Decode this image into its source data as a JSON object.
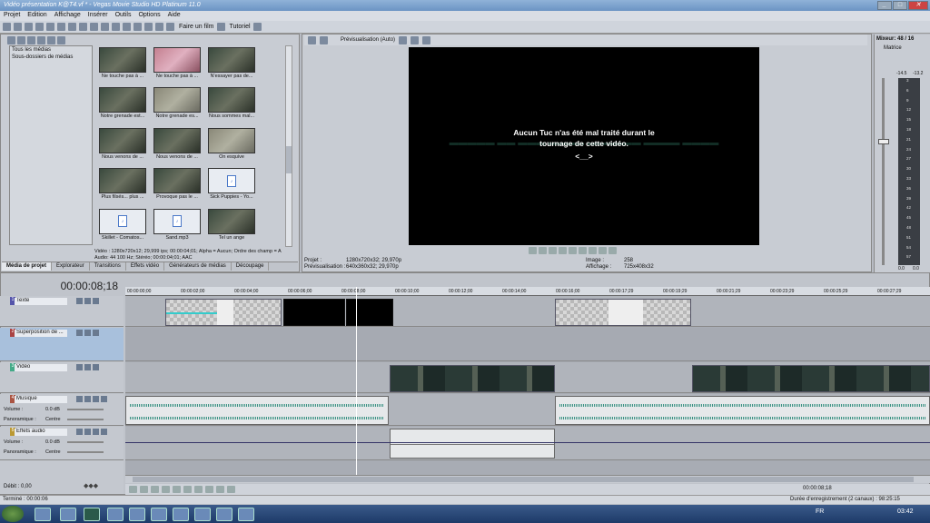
{
  "window": {
    "title": "Vidéo présentation K@T4.vf * - Vegas Movie Studio HD Platinum 11.0"
  },
  "menu": [
    "Projet",
    "Edition",
    "Affichage",
    "Insérer",
    "Outils",
    "Options",
    "Aide"
  ],
  "toolbar": {
    "make_movie": "Faire un film",
    "tutorial": "Tutoriel"
  },
  "explorer": {
    "items": [
      "Tous les médias",
      "Sous-dossiers de médias"
    ]
  },
  "media": [
    {
      "label": "Ne touche pas à ...",
      "kind": "video"
    },
    {
      "label": "Ne touche pas à ...",
      "kind": "pink"
    },
    {
      "label": "N'essayer pas de...",
      "kind": "video"
    },
    {
      "label": "Notre grenade est...",
      "kind": "video"
    },
    {
      "label": "Notre grenade es...",
      "kind": "light"
    },
    {
      "label": "Nous sommes mal...",
      "kind": "video"
    },
    {
      "label": "Nous venons de ...",
      "kind": "video"
    },
    {
      "label": "Nous venons de ...",
      "kind": "video"
    },
    {
      "label": "On esquive",
      "kind": "light"
    },
    {
      "label": "Plus filsés... plus ...",
      "kind": "video"
    },
    {
      "label": "Provoque pas le ...",
      "kind": "video"
    },
    {
      "label": "Sick Puppies - Yo...",
      "kind": "audio"
    },
    {
      "label": "Skillet - Comatos...",
      "kind": "audio"
    },
    {
      "label": "Sand.mp3",
      "kind": "audio"
    },
    {
      "label": "Tel un ange",
      "kind": "video"
    }
  ],
  "media_info": {
    "line1": "Vidéo : 1280x720x12; 29,999 ips; 00:00:04;01; Alpha = Aucun; Ordre des champ = A",
    "line2": "Audio: 44 100 Hz; Stéréo; 00:00:04;01; AAC"
  },
  "tabs": [
    "Média de projet",
    "Explorateur",
    "Transitions",
    "Effets vidéo",
    "Générateurs de médias",
    "Découpage"
  ],
  "preview": {
    "label": "Prévisualisation (Auto)",
    "text_line1": "Aucun Tuc n'as été mal traité durant le",
    "text_line2": "tournage de cette vidéo.",
    "text_line3": "<__>"
  },
  "preview_info": {
    "projet_label": "Projet :",
    "projet_value": "1280x720x32; 29,970p",
    "prev_label": "Prévisualisation :",
    "prev_value": "640x360x32; 29,970p",
    "image_label": "Image :",
    "image_value": "258",
    "affichage_label": "Affichage :",
    "affichage_value": "725x408x32"
  },
  "mixer": {
    "title": "Mixeur: 48 / 16",
    "matrix": "Matrice",
    "peak_left": "-14.5",
    "peak_right": "-13.2",
    "bottom_left": "0.0",
    "bottom_right": "0.0",
    "scale": [
      "3",
      "6",
      "9",
      "12",
      "15",
      "18",
      "21",
      "24",
      "27",
      "30",
      "33",
      "36",
      "39",
      "42",
      "45",
      "48",
      "51",
      "54",
      "57"
    ]
  },
  "timecode": "00:00:08;18",
  "ruler": [
    "00:00:00;00",
    "00:00:02;00",
    "00:00:04;00",
    "00:00:06;00",
    "00:00:08;00",
    "00:00:10;00",
    "00:00:12;00",
    "00:00:14;00",
    "00:00:16;00",
    "00:00:17;29",
    "00:00:19;29",
    "00:00:21;29",
    "00:00:23;29",
    "00:00:25;29",
    "00:00:27;29"
  ],
  "tracks": [
    {
      "num": "1",
      "name": "Texte"
    },
    {
      "num": "2",
      "name": "Superposition de ..."
    },
    {
      "num": "3",
      "name": "Vidéo"
    },
    {
      "num": "4",
      "name": "Musique",
      "vol_label": "Volume :",
      "vol_value": "0.0 dB",
      "pan_label": "Panoramique :",
      "pan_value": "Centre"
    },
    {
      "num": "5",
      "name": "Effets audio",
      "vol_label": "Volume :",
      "vol_value": "0.0 dB",
      "pan_label": "Panoramique :",
      "pan_value": "Centre"
    }
  ],
  "rate_label": "Débit : 0,00",
  "bottom": {
    "cursor_time": "00:00:08;18",
    "status_left": "Terminé : 00:00:06",
    "status_right": "Durée d'enregistrement (2 canaux) : 98:25:15"
  },
  "taskbar": {
    "lang": "FR",
    "clock": "03:42"
  }
}
